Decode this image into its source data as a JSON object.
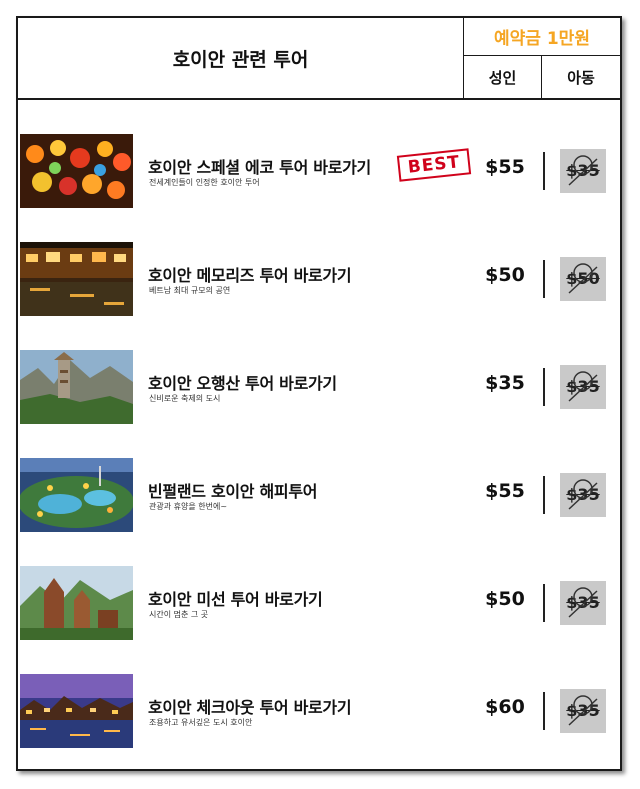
{
  "header": {
    "title": "호이안 관련 투어",
    "deposit": "예약금 1만원",
    "col_adult": "성인",
    "col_child": "아동"
  },
  "tours": [
    {
      "name": "호이안 스페셜 에코 투어 바로가기",
      "sub": "전세계인들이 인정한 호이안 투어",
      "adult": "$55",
      "child": "$35",
      "badge": "BEST",
      "image_icon": "lanterns-photo"
    },
    {
      "name": "호이안 메모리즈 투어 바로가기",
      "sub": "베트남 최대 규모의 공연",
      "adult": "$50",
      "child": "$50",
      "image_icon": "riverside-night-photo"
    },
    {
      "name": "호이안 오행산 투어 바로가기",
      "sub": "신비로운 축제의 도시",
      "adult": "$35",
      "child": "$35",
      "image_icon": "marble-mountain-photo"
    },
    {
      "name": "빈펄랜드 호이안 해피투어",
      "sub": "관광과 휴양을 한번에~",
      "adult": "$55",
      "child": "$35",
      "image_icon": "theme-park-photo"
    },
    {
      "name": "호이안 미선 투어 바로가기",
      "sub": "시간이 멈춘 그 곳",
      "adult": "$50",
      "child": "$35",
      "image_icon": "my-son-ruins-photo"
    },
    {
      "name": "호이안 체크아웃 투어 바로가기",
      "sub": "조용하고 유서깊은 도시 호이안",
      "adult": "$60",
      "child": "$35",
      "image_icon": "evening-town-photo"
    }
  ],
  "colors": {
    "deposit_text": "#f5a623",
    "best_badge": "#d0021b",
    "child_box": "#c9c9c9",
    "border": "#1a1a1a"
  }
}
